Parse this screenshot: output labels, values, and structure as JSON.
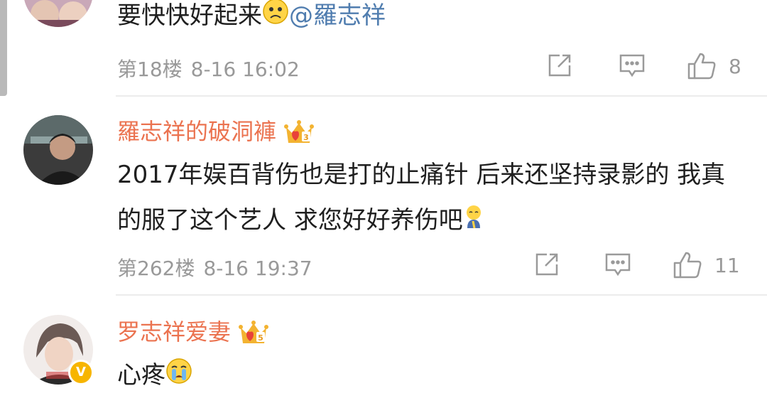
{
  "comments": [
    {
      "text": "要快快好起来",
      "mention": "@羅志祥",
      "emoji": "sad-face-emoji",
      "floor": "第18楼",
      "time": "8-16 16:02",
      "likes": "8"
    },
    {
      "username": "羅志祥的破洞褲",
      "vip_level": "3",
      "text": "2017年娱百背伤也是打的止痛针 后来还坚持录影的 我真的服了这个艺人 求您好好养伤吧",
      "emoji": "praying-emoji",
      "floor": "第262楼",
      "time": "8-16 19:37",
      "likes": "11"
    },
    {
      "username": "罗志祥爱妻",
      "vip_level": "5",
      "verified_badge": "V",
      "text": "心疼",
      "emoji": "crying-emoji"
    }
  ],
  "colors": {
    "username": "#eb7350",
    "mention": "#507daf",
    "meta": "#999999",
    "divider": "#ececec",
    "vip_gold": "#f3b331"
  }
}
